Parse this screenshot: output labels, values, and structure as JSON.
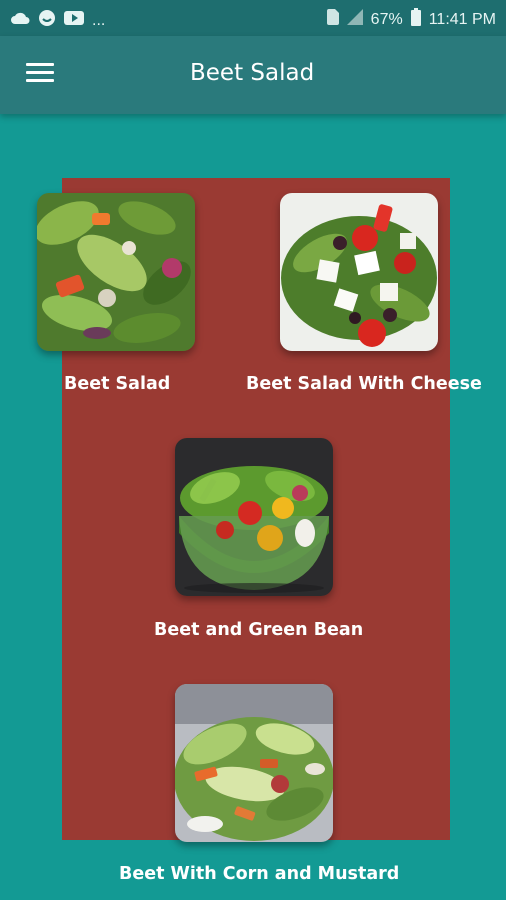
{
  "status_bar": {
    "battery": "67%",
    "time": "11:41 PM",
    "ellipsis": "..."
  },
  "app_bar": {
    "title": "Beet Salad",
    "menu_icon": "hamburger-menu-icon"
  },
  "colors": {
    "background": "#139a94",
    "app_bar": "#2a7a7c",
    "status_bar": "#1e6e6f",
    "panel": "#9a3a33"
  },
  "recipes": [
    {
      "label": "Beet Salad",
      "image": "mixed-green-salad-photo"
    },
    {
      "label": "Beet Salad With Cheese",
      "image": "greek-salad-with-feta-photo"
    },
    {
      "label": "Beet and Green Bean",
      "image": "salad-bowl-with-tomatoes-photo"
    },
    {
      "label": "Beet With Corn and Mustard",
      "image": "chopped-vegetable-salad-photo"
    }
  ]
}
